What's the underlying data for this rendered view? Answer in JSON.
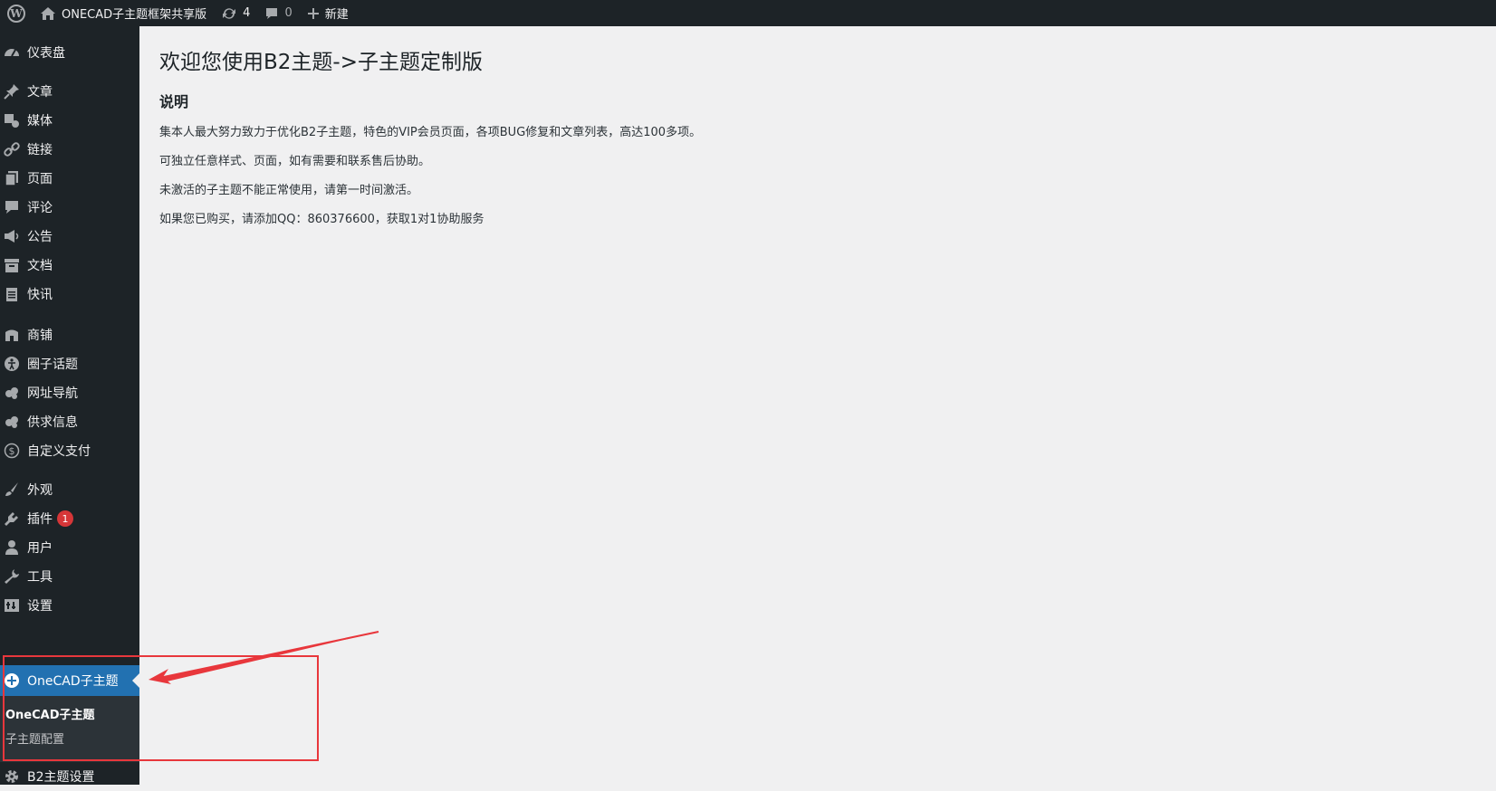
{
  "adminbar": {
    "site_name": "ONECAD子主题框架共享版",
    "updates_count": "4",
    "comments_count": "0",
    "new_label": "新建"
  },
  "sidebar": {
    "items": [
      {
        "label": "仪表盘",
        "icon": "dashboard-icon"
      },
      {
        "label": "文章",
        "icon": "pin-icon"
      },
      {
        "label": "媒体",
        "icon": "media-icon"
      },
      {
        "label": "链接",
        "icon": "link-icon"
      },
      {
        "label": "页面",
        "icon": "page-icon"
      },
      {
        "label": "评论",
        "icon": "comment-icon"
      },
      {
        "label": "公告",
        "icon": "megaphone-icon"
      },
      {
        "label": "文档",
        "icon": "archive-icon"
      },
      {
        "label": "快讯",
        "icon": "clipboard-icon"
      },
      {
        "label": "商铺",
        "icon": "store-icon"
      },
      {
        "label": "圈子话题",
        "icon": "universal-access-icon"
      },
      {
        "label": "网址导航",
        "icon": "gear-cluster-icon"
      },
      {
        "label": "供求信息",
        "icon": "gear-cluster-icon"
      },
      {
        "label": "自定义支付",
        "icon": "dollar-icon"
      },
      {
        "label": "外观",
        "icon": "brush-icon"
      },
      {
        "label": "插件",
        "icon": "plugin-icon",
        "badge": "1"
      },
      {
        "label": "用户",
        "icon": "user-icon"
      },
      {
        "label": "工具",
        "icon": "wrench-icon"
      },
      {
        "label": "设置",
        "icon": "settings-icon"
      }
    ],
    "current": {
      "label": "OneCAD子主题",
      "icon": "plus-circle-icon"
    },
    "submenu": [
      "OneCAD子主题",
      "子主题配置"
    ],
    "after": {
      "label": "B2主题设置",
      "icon": "gear-icon"
    }
  },
  "main": {
    "title": "欢迎您使用B2主题->子主题定制版",
    "section_title": "说明",
    "paragraphs": [
      "集本人最大努力致力于优化B2子主题，特色的VIP会员页面，各项BUG修复和文章列表，高达100多项。",
      "可独立任意样式、页面，如有需要和联系售后协助。",
      "未激活的子主题不能正常使用，请第一时间激活。",
      "如果您已购买，请添加QQ：860376600，获取1对1协助服务"
    ]
  },
  "colors": {
    "sidebar_bg": "#1d2327",
    "accent": "#2271b1",
    "annotation": "#e8373c"
  }
}
